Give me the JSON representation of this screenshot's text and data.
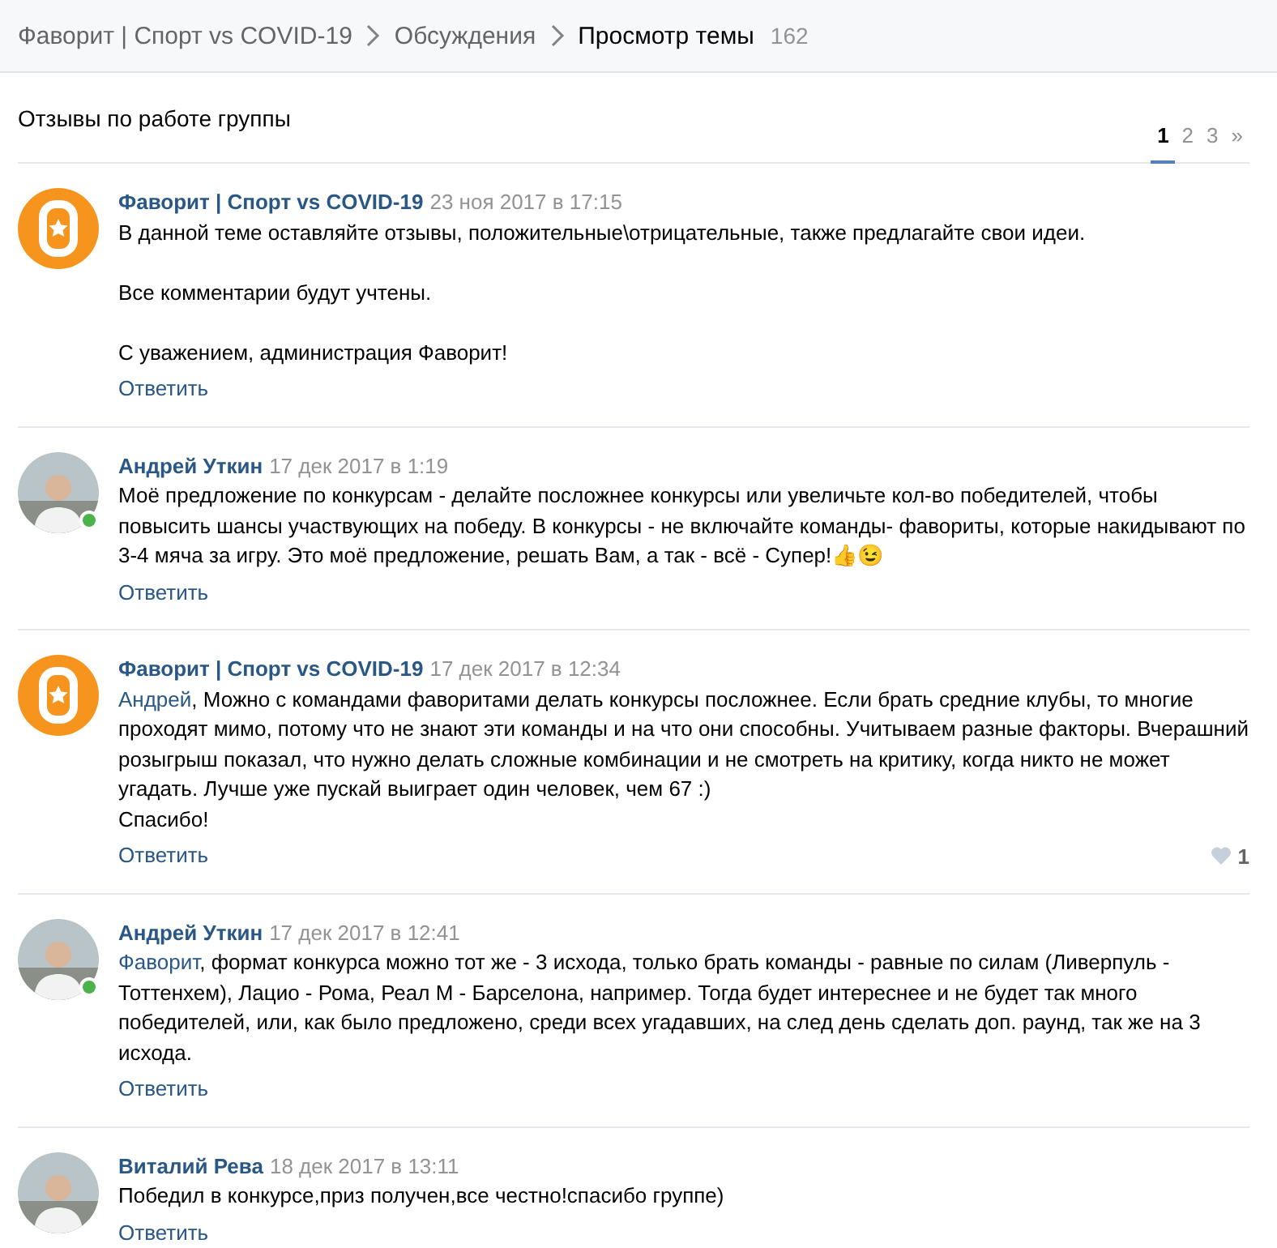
{
  "breadcrumbs": [
    {
      "label": "Фаворит | Спорт vs COVID-19"
    },
    {
      "label": "Обсуждения"
    },
    {
      "label": "Просмотр темы",
      "count": "162"
    }
  ],
  "topic": {
    "title": "Отзывы по работе группы"
  },
  "pagination": [
    {
      "label": "1",
      "selected": true
    },
    {
      "label": "2",
      "selected": false
    },
    {
      "label": "3",
      "selected": false
    },
    {
      "label": "»",
      "selected": false
    }
  ],
  "posts": [
    {
      "kind": "group",
      "author": "Фаворит | Спорт vs COVID-19",
      "date": "23 ноя 2017 в 17:15",
      "text": "В данной теме оставляйте отзывы, положительные\\отрицательные, также предлагайте свои идеи.\n\nВсе комментарии будут учтены.\n\nС уважением, администрация Фаворит!",
      "reply": "Ответить"
    },
    {
      "kind": "user",
      "online": true,
      "author": "Андрей Уткин",
      "date": "17 дек 2017 в 1:19",
      "text": "Моё предложение по конкурсам - делайте посложнее конкурсы или увеличьте кол-во победителей, чтобы повысить шансы участвующих на победу. В конкурсы - не включайте команды- фавориты, которые накидывают по 3-4 мяча за игру. Это моё предложение, решать Вам, а так - всё - Супер!👍😉",
      "reply": "Ответить"
    },
    {
      "kind": "group",
      "author": "Фаворит | Спорт vs COVID-19",
      "date": "17 дек 2017 в 12:34",
      "mention": "Андрей",
      "text": ", Можно с командами фаворитами делать конкурсы посложнее. Если брать средние клубы, то многие проходят мимо, потому что не знают эти команды и на что они способны. Учитываем разные факторы. Вчерашний розыгрыш показал, что нужно делать сложные комбинации и не смотреть на критику, когда никто не может угадать. Лучше уже пускай выиграет один человек, чем 67 :)\nСпасибо!",
      "reply": "Ответить",
      "likes": "1"
    },
    {
      "kind": "user",
      "online": true,
      "author": "Андрей Уткин",
      "date": "17 дек 2017 в 12:41",
      "mention": "Фаворит",
      "text": ", формат конкурса можно тот же - 3 исхода, только брать команды - равные по силам (Ливерпуль - Тоттенхем), Лацио - Рома, Реал М - Барселона, например. Тогда будет интереснее и не будет так много победителей, или, как было предложено, среди всех угадавших, на след день сделать доп. раунд, так же на 3 исхода.",
      "reply": "Ответить"
    },
    {
      "kind": "user",
      "online": false,
      "author": "Виталий Рева",
      "date": "18 дек 2017 в 13:11",
      "text": "Победил в конкурсе,приз получен,все честно!спасибо группе)",
      "reply": "Ответить"
    }
  ]
}
